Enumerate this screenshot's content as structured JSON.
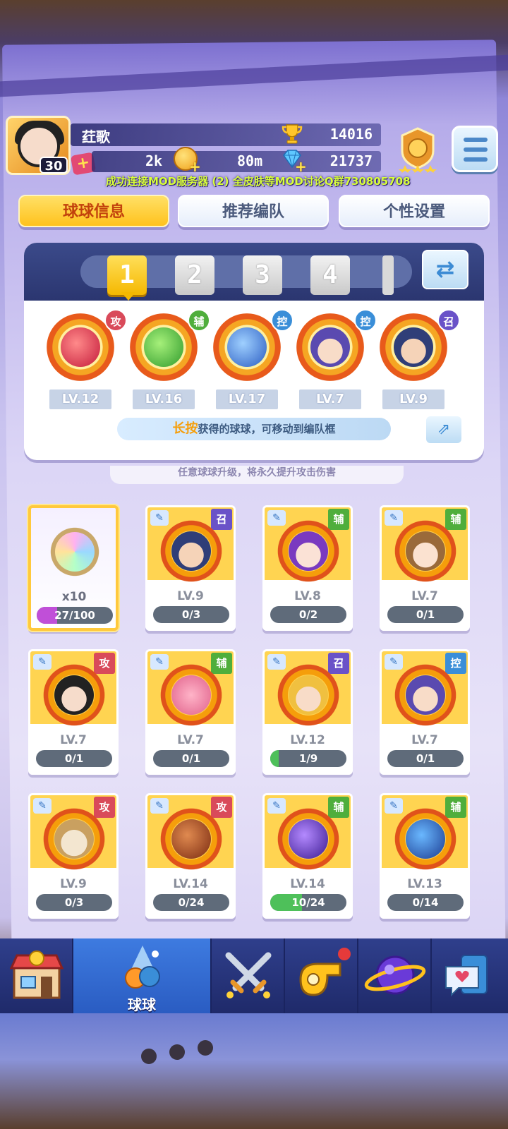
{
  "header": {
    "player_name": "荭歌",
    "avatar_level": "30",
    "trophies": "14016",
    "coins": "2k",
    "energy": "80m",
    "gems": "21737",
    "marquee": "成功连接MOD服务器  (2)  全皮肤等MOD讨论Q群730805708"
  },
  "tabs": [
    "球球信息",
    "推荐编队",
    "个性设置"
  ],
  "team": {
    "numbers": [
      "1",
      "2",
      "3",
      "4"
    ],
    "active_index": 0,
    "slots": [
      {
        "role": "攻",
        "level": "LV.12",
        "icon": "red-dragon-orb-icon"
      },
      {
        "role": "辅",
        "level": "LV.16",
        "icon": "green-arrow-orb-icon"
      },
      {
        "role": "控",
        "level": "LV.17",
        "icon": "blue-clock-orb-icon"
      },
      {
        "role": "控",
        "level": "LV.7",
        "icon": "purple-hair-hero-icon"
      },
      {
        "role": "召",
        "level": "LV.9",
        "icon": "bearded-hero-icon"
      }
    ],
    "hint_highlight": "长按",
    "hint_text": "获得的球球，可移动到编队框"
  },
  "tip_text": "任意球球升级，将永久提升攻击伤害",
  "inventory": {
    "special": {
      "count": "x10",
      "progress": "27/100",
      "fraction": 0.27
    },
    "cards": [
      {
        "role": "召",
        "level": "LV.9",
        "progress": "0/3",
        "fraction": 0,
        "icon": "bearded-hero-icon"
      },
      {
        "role": "辅",
        "level": "LV.8",
        "progress": "0/2",
        "fraction": 0,
        "icon": "purple-haired-girl-icon"
      },
      {
        "role": "辅",
        "level": "LV.7",
        "progress": "0/1",
        "fraction": 0,
        "icon": "brown-haired-girl-icon"
      },
      {
        "role": "攻",
        "level": "LV.7",
        "progress": "0/1",
        "fraction": 0,
        "icon": "dark-haired-hero-icon"
      },
      {
        "role": "辅",
        "level": "LV.7",
        "progress": "0/1",
        "fraction": 0,
        "icon": "pink-monster-icon"
      },
      {
        "role": "召",
        "level": "LV.12",
        "progress": "1/9",
        "fraction": 0.11,
        "icon": "blonde-hero-icon"
      },
      {
        "role": "控",
        "level": "LV.7",
        "progress": "0/1",
        "fraction": 0,
        "icon": "purple-hair-hero-icon"
      },
      {
        "role": "攻",
        "level": "LV.9",
        "progress": "0/3",
        "fraction": 0,
        "icon": "old-sage-icon"
      },
      {
        "role": "攻",
        "level": "LV.14",
        "progress": "0/24",
        "fraction": 0,
        "icon": "infinity-orb-icon"
      },
      {
        "role": "辅",
        "level": "LV.14",
        "progress": "10/24",
        "fraction": 0.42,
        "icon": "lightning-orb-icon"
      },
      {
        "role": "辅",
        "level": "LV.13",
        "progress": "0/14",
        "fraction": 0,
        "icon": "hex-planet-orb-icon"
      }
    ]
  },
  "bottom_nav": [
    {
      "label": "",
      "icon": "shop-icon"
    },
    {
      "label": "球球",
      "icon": "balls-icon"
    },
    {
      "label": "",
      "icon": "swords-icon"
    },
    {
      "label": "",
      "icon": "whistle-icon"
    },
    {
      "label": "",
      "icon": "planet-icon"
    },
    {
      "label": "",
      "icon": "chat-heart-icon"
    }
  ],
  "colors": {
    "attack": "#d94a5a",
    "support": "#4fae3c",
    "control": "#3a8ed8",
    "summon": "#6a52c8",
    "active_tab": "#ffc21d"
  }
}
